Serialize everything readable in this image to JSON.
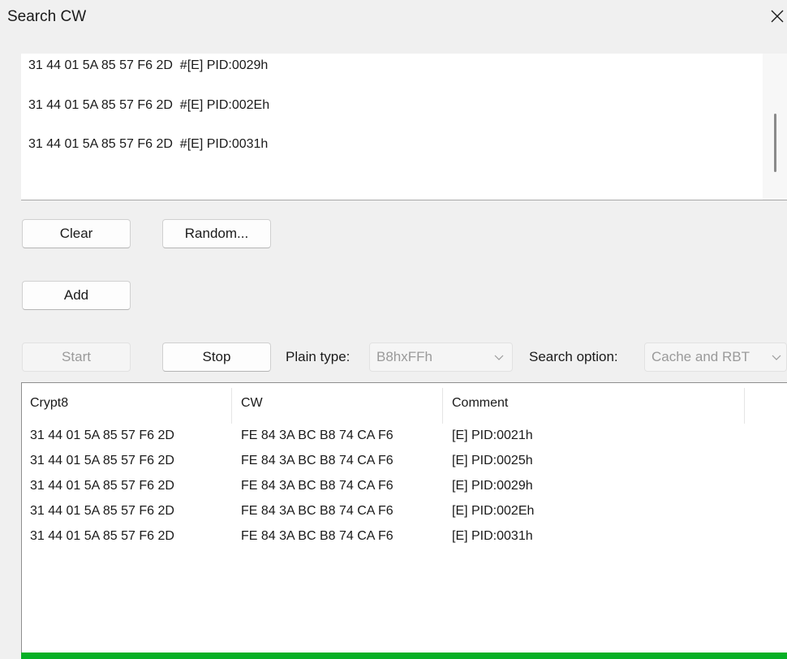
{
  "window": {
    "title": "Search CW",
    "close_glyph": "×"
  },
  "input_list": {
    "lines": [
      "31 44 01 5A 85 57 F6 2D  #[E] PID:0029h",
      "31 44 01 5A 85 57 F6 2D  #[E] PID:002Eh",
      "31 44 01 5A 85 57 F6 2D  #[E] PID:0031h"
    ]
  },
  "buttons": {
    "clear": "Clear",
    "random": "Random...",
    "add": "Add",
    "start": "Start",
    "stop": "Stop"
  },
  "options": {
    "plain_type_label": "Plain type:",
    "plain_type_value": "B8hxFFh",
    "search_option_label": "Search option:",
    "search_option_value": "Cache and RBT"
  },
  "results": {
    "columns": [
      "Crypt8",
      "CW",
      "Comment"
    ],
    "rows": [
      [
        "31 44 01 5A 85 57 F6 2D",
        "FE 84 3A BC B8 74 CA F6",
        "[E] PID:0021h"
      ],
      [
        "31 44 01 5A 85 57 F6 2D",
        "FE 84 3A BC B8 74 CA F6",
        "[E] PID:0025h"
      ],
      [
        "31 44 01 5A 85 57 F6 2D",
        "FE 84 3A BC B8 74 CA F6",
        "[E] PID:0029h"
      ],
      [
        "31 44 01 5A 85 57 F6 2D",
        "FE 84 3A BC B8 74 CA F6",
        "[E] PID:002Eh"
      ],
      [
        "31 44 01 5A 85 57 F6 2D",
        "FE 84 3A BC B8 74 CA F6",
        "[E] PID:0031h"
      ]
    ]
  },
  "colors": {
    "progress": "#06b025",
    "window_bg": "#f0f0f0"
  }
}
